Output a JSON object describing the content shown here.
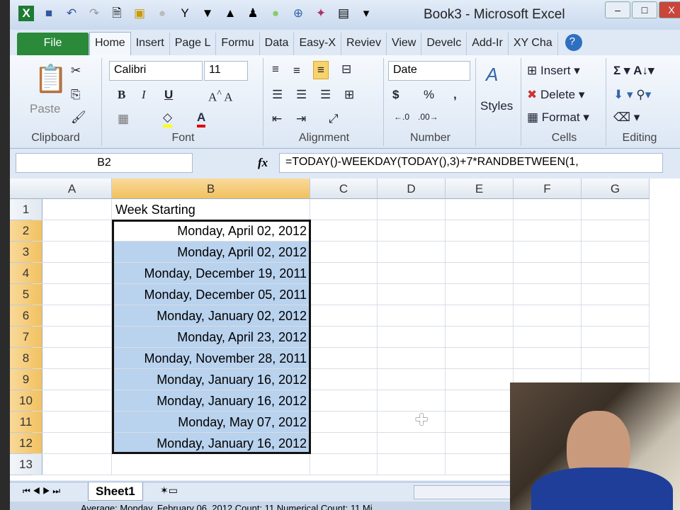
{
  "window": {
    "title": "Book3  -  Microsoft Excel"
  },
  "tabs": [
    "File",
    "Home",
    "Insert",
    "Page L",
    "Formu",
    "Data",
    "Easy-X",
    "Reviev",
    "View",
    "Develc",
    "Add-Ir",
    "XY Cha"
  ],
  "ribbon": {
    "clipboard": {
      "label": "Clipboard",
      "paste": "Paste"
    },
    "font": {
      "label": "Font",
      "name": "Calibri",
      "size": "11",
      "bold": "B",
      "italic": "I",
      "underline": "U"
    },
    "alignment": {
      "label": "Alignment"
    },
    "number": {
      "label": "Number",
      "format": "Date",
      "currency": "$",
      "percent": "%",
      "comma": ","
    },
    "styles": {
      "label": "Styles"
    },
    "cells": {
      "label": "Cells",
      "insert": "Insert",
      "delete": "Delete",
      "format": "Format"
    },
    "editing": {
      "label": "Editing"
    }
  },
  "formula_bar": {
    "name_box": "B2",
    "fx": "fx",
    "formula": "=TODAY()-WEEKDAY(TODAY(),3)+7*RANDBETWEEN(1,"
  },
  "columns": [
    "A",
    "B",
    "C",
    "D",
    "E",
    "F",
    "G"
  ],
  "rows": [
    "1",
    "2",
    "3",
    "4",
    "5",
    "6",
    "7",
    "8",
    "9",
    "10",
    "11",
    "12",
    "13"
  ],
  "cells": {
    "B1": "Week Starting",
    "B": [
      "Monday, April 02, 2012",
      "Monday, April 02, 2012",
      "Monday, December 19, 2011",
      "Monday, December 05, 2011",
      "Monday, January 02, 2012",
      "Monday, April 23, 2012",
      "Monday, November 28, 2011",
      "Monday, January 16, 2012",
      "Monday, January 16, 2012",
      "Monday, May 07, 2012",
      "Monday, January 16, 2012"
    ]
  },
  "sheets": [
    "Sheet1"
  ],
  "status": {
    "text": "Average: Monday, February 06, 2012    Count: 11    Numerical Count: 11    Mi"
  }
}
